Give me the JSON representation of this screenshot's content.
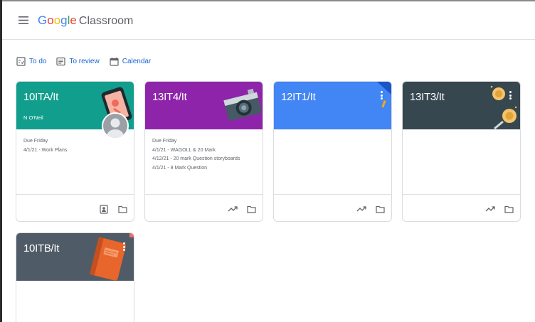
{
  "app": {
    "logo_google": "Google",
    "logo_product": "Classroom"
  },
  "toolbar": [
    {
      "label": "To do",
      "icon": "todo-icon"
    },
    {
      "label": "To review",
      "icon": "review-icon"
    },
    {
      "label": "Calendar",
      "icon": "calendar-icon"
    }
  ],
  "colors": {
    "teal": "#129e8c",
    "purple": "#8e24aa",
    "blue": "#4285f4",
    "dark_slate": "#37474f",
    "slate": "#4f5b66",
    "link": "#1967d2"
  },
  "cards": [
    {
      "title": "10ITA/It",
      "teacher": "N O'Neil",
      "due_label": "Due Friday",
      "assignments": [
        "4/1/21 - Work Plans"
      ],
      "footer_icons": [
        "gradebook-icon",
        "folder-icon"
      ]
    },
    {
      "title": "13IT4/It",
      "teacher": "",
      "due_label": "Due Friday",
      "assignments": [
        "4/1/21 - WAGOLL & 20 Mark",
        "4/12/21 - 20 mark Question storyboards",
        "4/1/21 - 8 Mark Question"
      ],
      "footer_icons": [
        "trending-icon",
        "folder-icon"
      ]
    },
    {
      "title": "12IT1/It",
      "teacher": "",
      "due_label": "",
      "assignments": [],
      "footer_icons": [
        "trending-icon",
        "folder-icon"
      ]
    },
    {
      "title": "13IT3/It",
      "teacher": "",
      "due_label": "",
      "assignments": [],
      "footer_icons": [
        "trending-icon",
        "folder-icon"
      ]
    },
    {
      "title": "10ITB/It",
      "teacher": "",
      "due_label": "",
      "assignments": [],
      "footer_icons": []
    }
  ]
}
